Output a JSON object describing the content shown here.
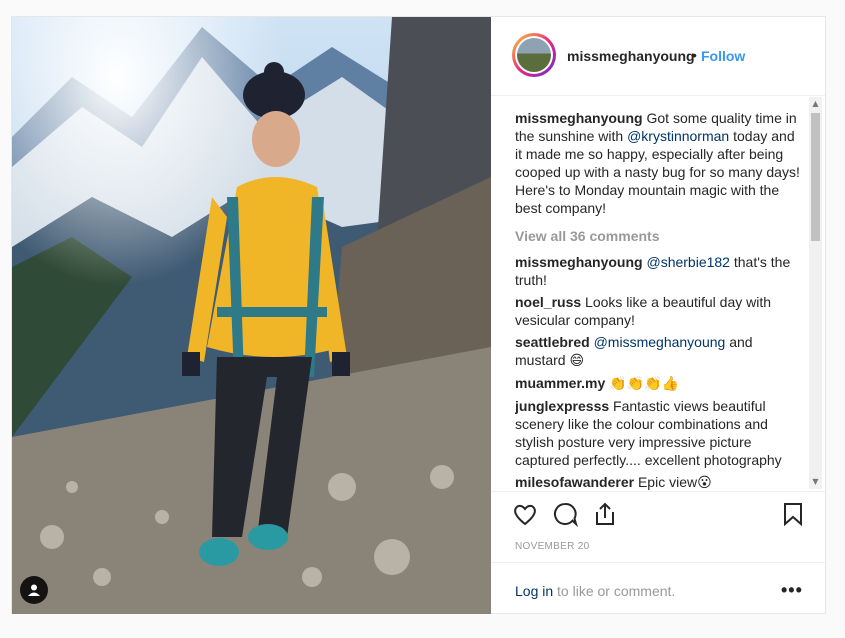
{
  "post": {
    "username": "missmeghanyoung",
    "separator": "•",
    "follow_label": "Follow",
    "image_alt_icon": "user-tag-icon",
    "comments_list": [
      {
        "user": "missmeghanyoung",
        "parts": [
          "Got some quality time in the sunshine with ",
          "@krystinnorman",
          " today and it made me so happy, especially after being cooped up with a nasty bug for so many days! Here's to Monday mountain magic with the best company!"
        ]
      },
      {
        "user": "missmeghanyoung",
        "parts": [
          "",
          "@sherbie182",
          " that's the truth!"
        ]
      },
      {
        "user": "noel_russ",
        "parts": [
          "Looks like a beautiful day with vesicular company!"
        ]
      },
      {
        "user": "seattlebred",
        "parts": [
          "",
          "@missmeghanyoung",
          " and mustard "
        ],
        "emoji": "😄"
      },
      {
        "user": "muammer.my",
        "emoji": "👏👏👏👍"
      },
      {
        "user": "junglexpresss",
        "parts": [
          "Fantastic views beautiful scenery like the colour combinations and stylish posture very impressive picture captured perfectly.... excellent photography"
        ]
      },
      {
        "user": "milesofawanderer",
        "parts": [
          "Epic view"
        ],
        "emoji": "😮"
      }
    ],
    "view_all_label": "View all 36 comments",
    "date": "NOVEMBER 20",
    "login_link": "Log in",
    "login_rest": " to like or comment.",
    "more_label": "•••",
    "icons": [
      "heart-icon",
      "comment-icon",
      "share-icon",
      "bookmark-icon"
    ],
    "scroll_up": "▲",
    "scroll_down": "▼"
  },
  "colors": {
    "link": "#3897f0",
    "mention": "#003569",
    "muted": "#999999"
  }
}
